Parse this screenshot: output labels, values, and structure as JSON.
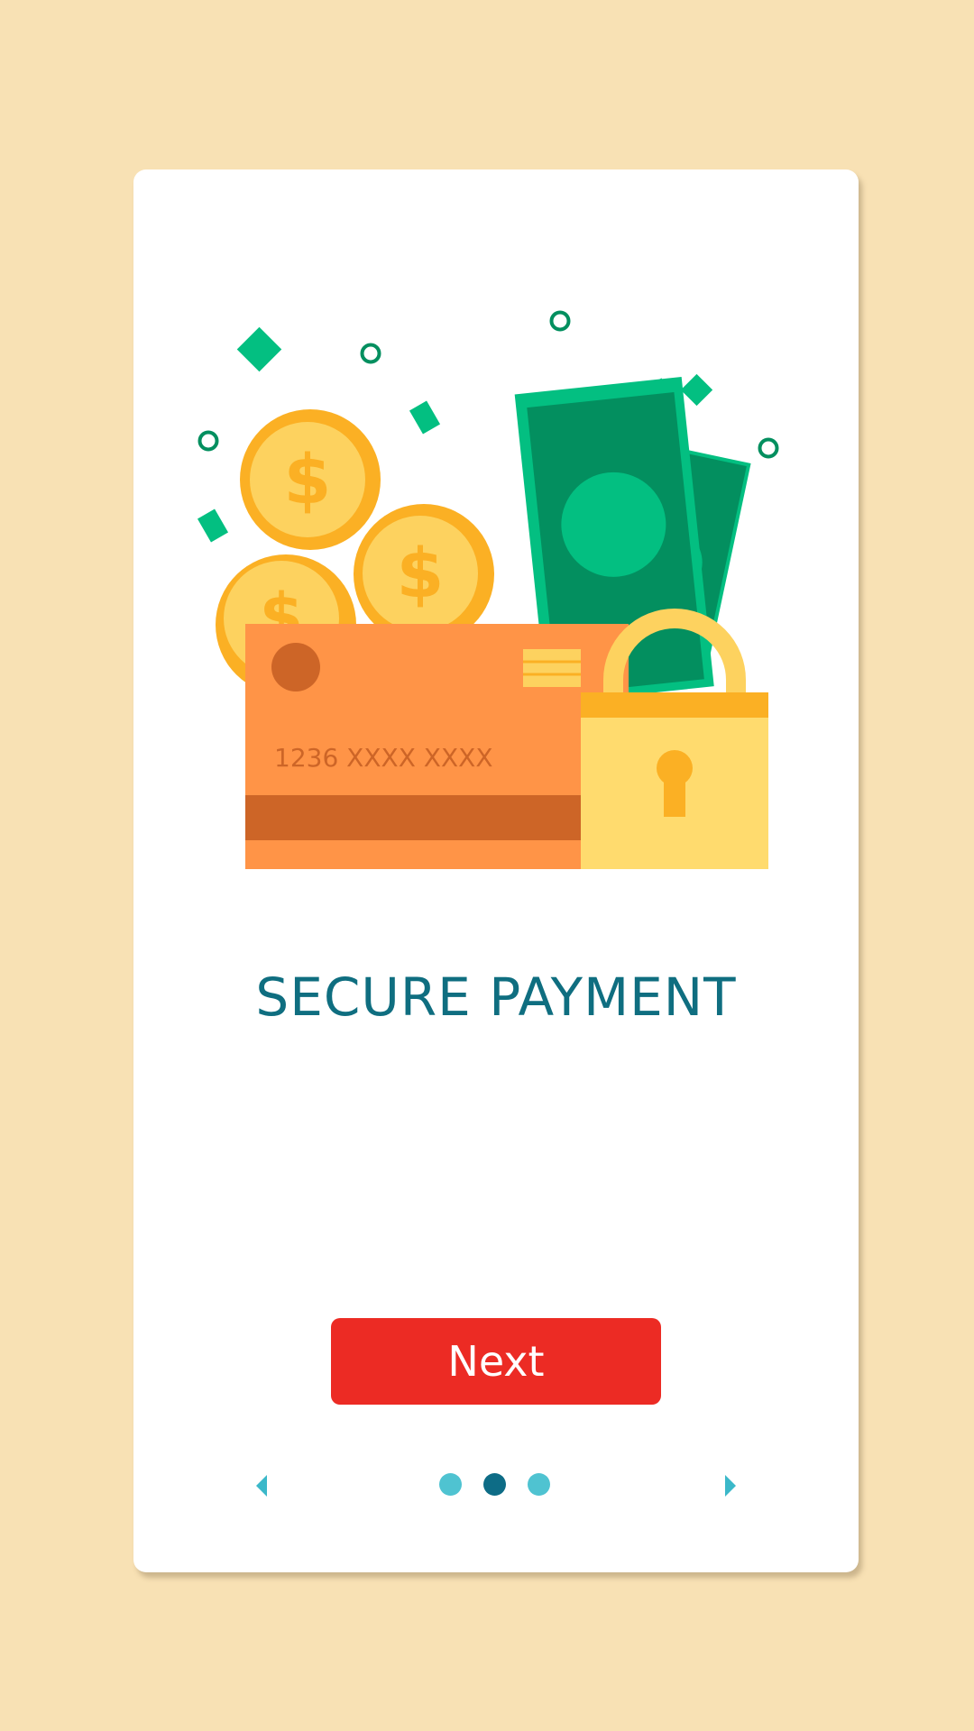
{
  "card": {
    "illustration": {
      "card_number": "1236 XXXX XXXX",
      "colors": {
        "coin": "#fbb024",
        "coin_face": "#fdd25f",
        "bill": "#038f5f",
        "bill_accent": "#00c081",
        "credit_card": "#ff9447",
        "stripe": "#cd6527",
        "lock_body": "#ffdb6e",
        "lock_shackle": "#fbb024",
        "confetti": "#03bf81"
      }
    },
    "title": "SECURE PAYMENT",
    "next_button_label": "Next",
    "pager": {
      "current_page": 2,
      "total_pages": 3,
      "prev_icon": "chevron-left-icon",
      "next_icon": "chevron-right-icon"
    }
  },
  "colors": {
    "background": "#f8e1b4",
    "title": "#0f6e80",
    "button": "#ec2b24",
    "dot_active": "#0d6c86",
    "dot_inactive": "#4fc3d1"
  }
}
